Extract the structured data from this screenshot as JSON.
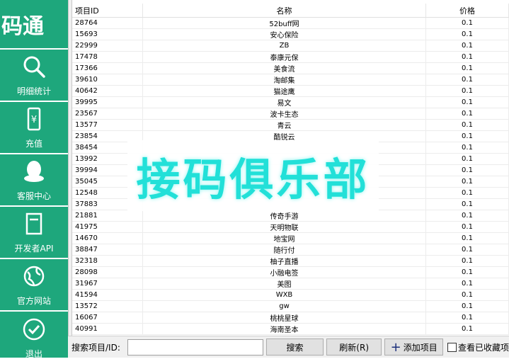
{
  "brand": "码通",
  "nav": [
    {
      "icon": "search-icon",
      "label": "明细统计"
    },
    {
      "icon": "recharge-icon",
      "label": "充值"
    },
    {
      "icon": "qq-penguin-icon",
      "label": "客服中心"
    },
    {
      "icon": "document-icon",
      "label": "开发者API"
    },
    {
      "icon": "globe-icon",
      "label": "官方网站"
    },
    {
      "icon": "check-circle-icon",
      "label": "退出"
    }
  ],
  "table": {
    "headers": {
      "id": "项目ID",
      "name": "名称",
      "price": "价格"
    },
    "rows": [
      {
        "id": "28764",
        "name": "52buff网",
        "price": "0.1"
      },
      {
        "id": "15693",
        "name": "安心保险",
        "price": "0.1"
      },
      {
        "id": "22999",
        "name": "ZB",
        "price": "0.1"
      },
      {
        "id": "17478",
        "name": "泰康元保",
        "price": "0.1"
      },
      {
        "id": "17366",
        "name": "美食流",
        "price": "0.1"
      },
      {
        "id": "39610",
        "name": "淘邮集",
        "price": "0.1"
      },
      {
        "id": "40642",
        "name": "猫途鹰",
        "price": "0.1"
      },
      {
        "id": "39995",
        "name": "易文",
        "price": "0.1"
      },
      {
        "id": "23567",
        "name": "波卡生态",
        "price": "0.1"
      },
      {
        "id": "13577",
        "name": "青云",
        "price": "0.1"
      },
      {
        "id": "23854",
        "name": "酷锐云",
        "price": "0.1"
      },
      {
        "id": "38454",
        "name": "",
        "price": "0.1"
      },
      {
        "id": "13992",
        "name": "",
        "price": "0.1"
      },
      {
        "id": "39994",
        "name": "",
        "price": "0.1"
      },
      {
        "id": "35045",
        "name": "",
        "price": "0.1"
      },
      {
        "id": "12548",
        "name": "",
        "price": "0.1"
      },
      {
        "id": "37883",
        "name": "",
        "price": "0.1"
      },
      {
        "id": "21881",
        "name": "传奇手游",
        "price": "0.1"
      },
      {
        "id": "41975",
        "name": "天明物联",
        "price": "0.1"
      },
      {
        "id": "14670",
        "name": "地宝网",
        "price": "0.1"
      },
      {
        "id": "38847",
        "name": "随行付",
        "price": "0.1"
      },
      {
        "id": "32318",
        "name": "柚子直播",
        "price": "0.1"
      },
      {
        "id": "28098",
        "name": "小融电签",
        "price": "0.1"
      },
      {
        "id": "31967",
        "name": "美图",
        "price": "0.1"
      },
      {
        "id": "41594",
        "name": "WXB",
        "price": "0.1"
      },
      {
        "id": "13572",
        "name": "gw",
        "price": "0.1"
      },
      {
        "id": "16067",
        "name": "桃桃星球",
        "price": "0.1"
      },
      {
        "id": "40991",
        "name": "海南圣本",
        "price": "0.1"
      }
    ]
  },
  "watermark": "接码俱乐部",
  "bottom": {
    "search_label": "搜索项目/ID:",
    "search_value": "",
    "search_button": "搜索",
    "refresh_button": "刷新(R)",
    "add_button": "添加项目",
    "favorites_checkbox": "查看已收藏项"
  },
  "colors": {
    "sidebar": "#1ea77c",
    "watermark": "#22e0d8"
  }
}
